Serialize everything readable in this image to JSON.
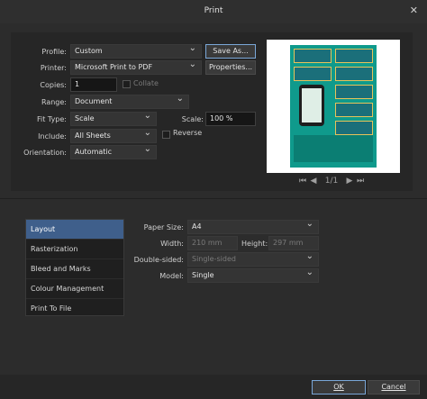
{
  "window": {
    "title": "Print",
    "close_glyph": "✕"
  },
  "general": {
    "profile_label": "Profile:",
    "profile_value": "Custom",
    "save_as": "Save As...",
    "printer_label": "Printer:",
    "printer_value": "Microsoft Print to PDF",
    "properties": "Properties...",
    "copies_label": "Copies:",
    "copies_value": "1",
    "collate_label": "Collate",
    "range_label": "Range:",
    "range_value": "Document",
    "fit_type_label": "Fit Type:",
    "fit_type_value": "Scale",
    "scale_label": "Scale:",
    "scale_value": "100 %",
    "include_label": "Include:",
    "include_value": "All Sheets",
    "reverse_label": "Reverse",
    "orientation_label": "Orientation:",
    "orientation_value": "Automatic"
  },
  "preview": {
    "page": "1/1"
  },
  "categories": [
    {
      "label": "Layout",
      "selected": true
    },
    {
      "label": "Rasterization"
    },
    {
      "label": "Bleed and Marks"
    },
    {
      "label": "Colour Management"
    },
    {
      "label": "Print To File"
    }
  ],
  "layout": {
    "paper_size_label": "Paper Size:",
    "paper_size_value": "A4",
    "width_label": "Width:",
    "width_value": "210 mm",
    "height_label": "Height:",
    "height_value": "297 mm",
    "double_sided_label": "Double-sided:",
    "double_sided_value": "Single-sided",
    "model_label": "Model:",
    "model_value": "Single"
  },
  "footer": {
    "ok": "OK",
    "cancel": "Cancel"
  }
}
